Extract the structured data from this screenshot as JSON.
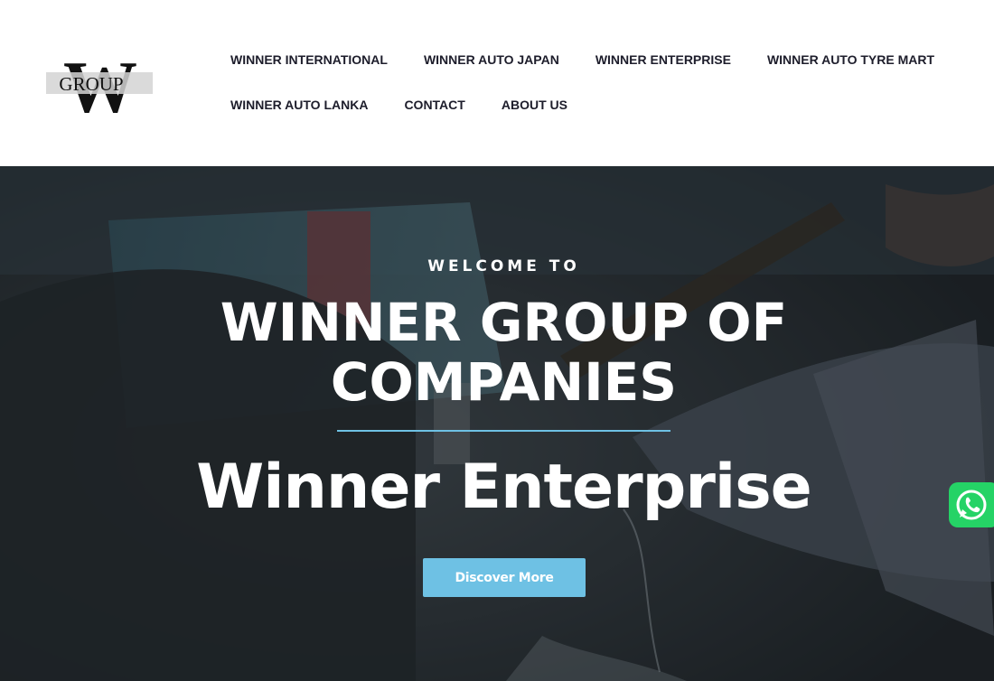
{
  "brand": {
    "logo_letter": "W",
    "logo_text": "GROUP"
  },
  "nav": {
    "row1": [
      "WINNER INTERNATIONAL",
      "WINNER AUTO JAPAN",
      "WINNER ENTERPRISE",
      "WINNER AUTO TYRE MART"
    ],
    "row2": [
      "WINNER AUTO LANKA",
      "CONTACT",
      "ABOUT US"
    ]
  },
  "hero": {
    "welcome": "WELCOME TO",
    "headline_line1": "WINNER GROUP OF",
    "headline_line2": "COMPANIES",
    "subbrand": "Winner Enterprise",
    "cta_label": "Discover More"
  },
  "colors": {
    "accent": "#6ec1e4",
    "nav_text": "#1d1d2b",
    "whatsapp": "#25d366"
  },
  "icons": {
    "floating": "whatsapp-icon"
  }
}
